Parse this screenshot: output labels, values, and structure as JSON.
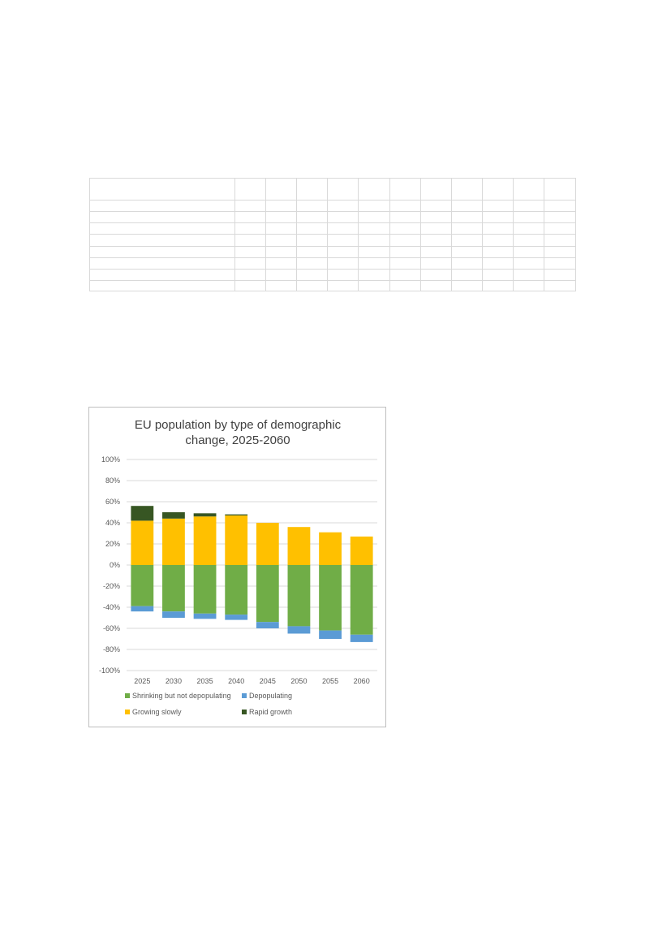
{
  "chart_data": {
    "type": "bar",
    "stacked": true,
    "title": "EU population by type of demographic change, 2025-2060",
    "title_lines": [
      "EU population by type of demographic",
      "change, 2025-2060"
    ],
    "categories": [
      "2025",
      "2030",
      "2035",
      "2040",
      "2045",
      "2050",
      "2055",
      "2060"
    ],
    "ylim": [
      -100,
      100
    ],
    "yticks": [
      100,
      80,
      60,
      40,
      20,
      0,
      -20,
      -40,
      -60,
      -80,
      -100
    ],
    "ytick_labels": [
      "100%",
      "80%",
      "60%",
      "40%",
      "20%",
      "0%",
      "-20%",
      "-40%",
      "-60%",
      "-80%",
      "-100%"
    ],
    "grid": true,
    "legend_position": "bottom",
    "series": [
      {
        "name": "Shrinking but not depopulating",
        "color": "#70ad47",
        "values": [
          -39,
          -44,
          -46,
          -47,
          -54,
          -58,
          -62,
          -66
        ]
      },
      {
        "name": "Depopulating",
        "color": "#5b9bd5",
        "values": [
          -5,
          -6,
          -5,
          -5,
          -6,
          -7,
          -8,
          -7
        ]
      },
      {
        "name": "Growing slowly",
        "color": "#ffc000",
        "values": [
          42,
          44,
          46,
          47,
          40,
          36,
          31,
          27
        ]
      },
      {
        "name": "Rapid growth",
        "color": "#375623",
        "values": [
          14,
          6,
          3,
          1,
          0,
          0,
          0,
          0
        ]
      }
    ]
  }
}
